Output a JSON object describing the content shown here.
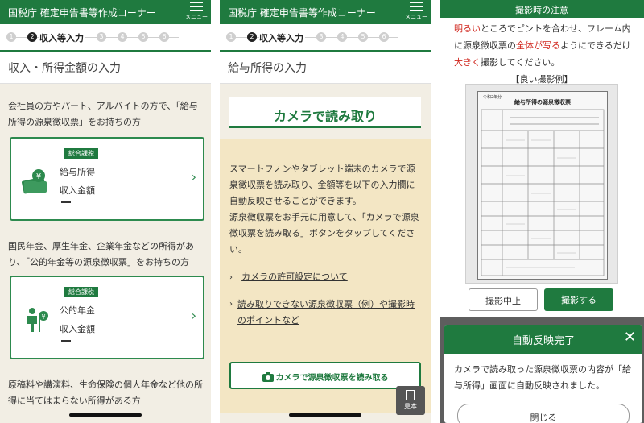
{
  "app": {
    "header_title": "国税庁 確定申告書等作成コーナー",
    "menu_label": "メニュー"
  },
  "stepper": {
    "current_label": "収入等入力",
    "current_num": "2",
    "step1": "1",
    "step3": "3",
    "step4": "4",
    "step5": "5",
    "step6": "6"
  },
  "screen1": {
    "section_title": "収入・所得金額の入力",
    "intro1": "会社員の方やパート、アルバイトの方で、「給与所得の源泉徴収票」をお持ちの方",
    "card1": {
      "badge": "総合課税",
      "line1": "給与所得",
      "line2": "収入金額"
    },
    "intro2": "国民年金、厚生年金、企業年金などの所得があり、「公的年金等の源泉徴収票」をお持ちの方",
    "card2": {
      "badge": "総合課税",
      "line1": "公的年金",
      "line2": "収入金額"
    },
    "intro3": "原稿料や講演料、生命保険の個人年金など他の所得に当てはまらない所得がある方"
  },
  "screen2": {
    "section_title": "給与所得の入力",
    "camera_title": "カメラで読み取り",
    "body1": "スマートフォンやタブレット端末のカメラで源泉徴収票を読み取り、金額等を以下の入力欄に自動反映させることができます。",
    "body2": "源泉徴収票をお手元に用意して、「カメラで源泉徴収票を読み取る」ボタンをタップしてください。",
    "link1": "カメラの許可設定について",
    "link2": "読み取りできない源泉徴収票（例）や撮影時のポイントなど",
    "camera_button": "カメラで源泉徴収票を読み取る",
    "sample_label": "見本"
  },
  "screen3": {
    "header": "撮影時の注意",
    "t1": "明るい",
    "t2": "ところでピントを合わせ、フレーム内に源泉徴収票の",
    "t3": "全体が写る",
    "t4": "ようにできるだけ",
    "t5": "大きく",
    "t6": "撮影してください。",
    "good_example": "【良い撮影例】",
    "form_title": "給与所得の源泉徴収票",
    "form_year": "令和2年分",
    "stop_button": "撮影中止",
    "shoot_button": "撮影する",
    "modal": {
      "title": "自動反映完了",
      "body": "カメラで読み取った源泉徴収票の内容が「給与所得」画面に自動反映されました。",
      "close_button": "閉じる"
    }
  },
  "colors": {
    "primary_green": "#1f7a3f",
    "highlight_red": "#d0261d",
    "camera_panel": "#f3e6c4"
  }
}
